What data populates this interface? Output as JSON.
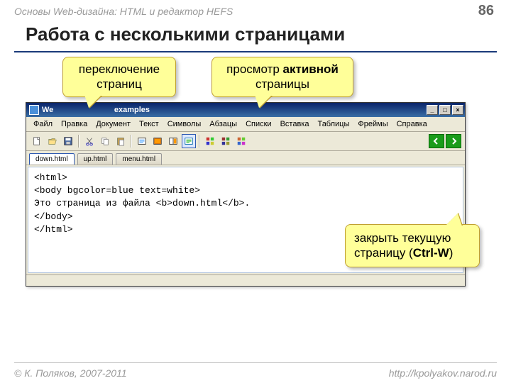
{
  "header": {
    "course": "Основы Web-дизайна: HTML и редактор HEFS",
    "page": "86"
  },
  "title": "Работа с несколькими страницами",
  "callouts": {
    "switch": "переключение страниц",
    "view_prefix": "просмотр ",
    "view_bold": "активной",
    "view_suffix": " страницы",
    "close_prefix": "закрыть текущую страницу (",
    "close_bold": "Ctrl-W",
    "close_suffix": ")"
  },
  "window": {
    "title_prefix": "We",
    "title_mid": "examples",
    "menu": [
      "Файл",
      "Правка",
      "Документ",
      "Текст",
      "Символы",
      "Абзацы",
      "Списки",
      "Вставка",
      "Таблицы",
      "Фреймы",
      "Справка"
    ],
    "tabs": [
      "down.html",
      "up.html",
      "menu.html"
    ],
    "code": {
      "l1": "<html>",
      "l2": "<body bgcolor=blue text=white>",
      "l3a": "Это страница из файла ",
      "l3b": "<b>",
      "l3c": "down.html",
      "l3d": "</b>",
      "l3e": ".",
      "l4": "</body>",
      "l5": "</html>"
    }
  },
  "footer": {
    "copyright": "© К. Поляков, 2007-2011",
    "url": "http://kpolyakov.narod.ru"
  }
}
